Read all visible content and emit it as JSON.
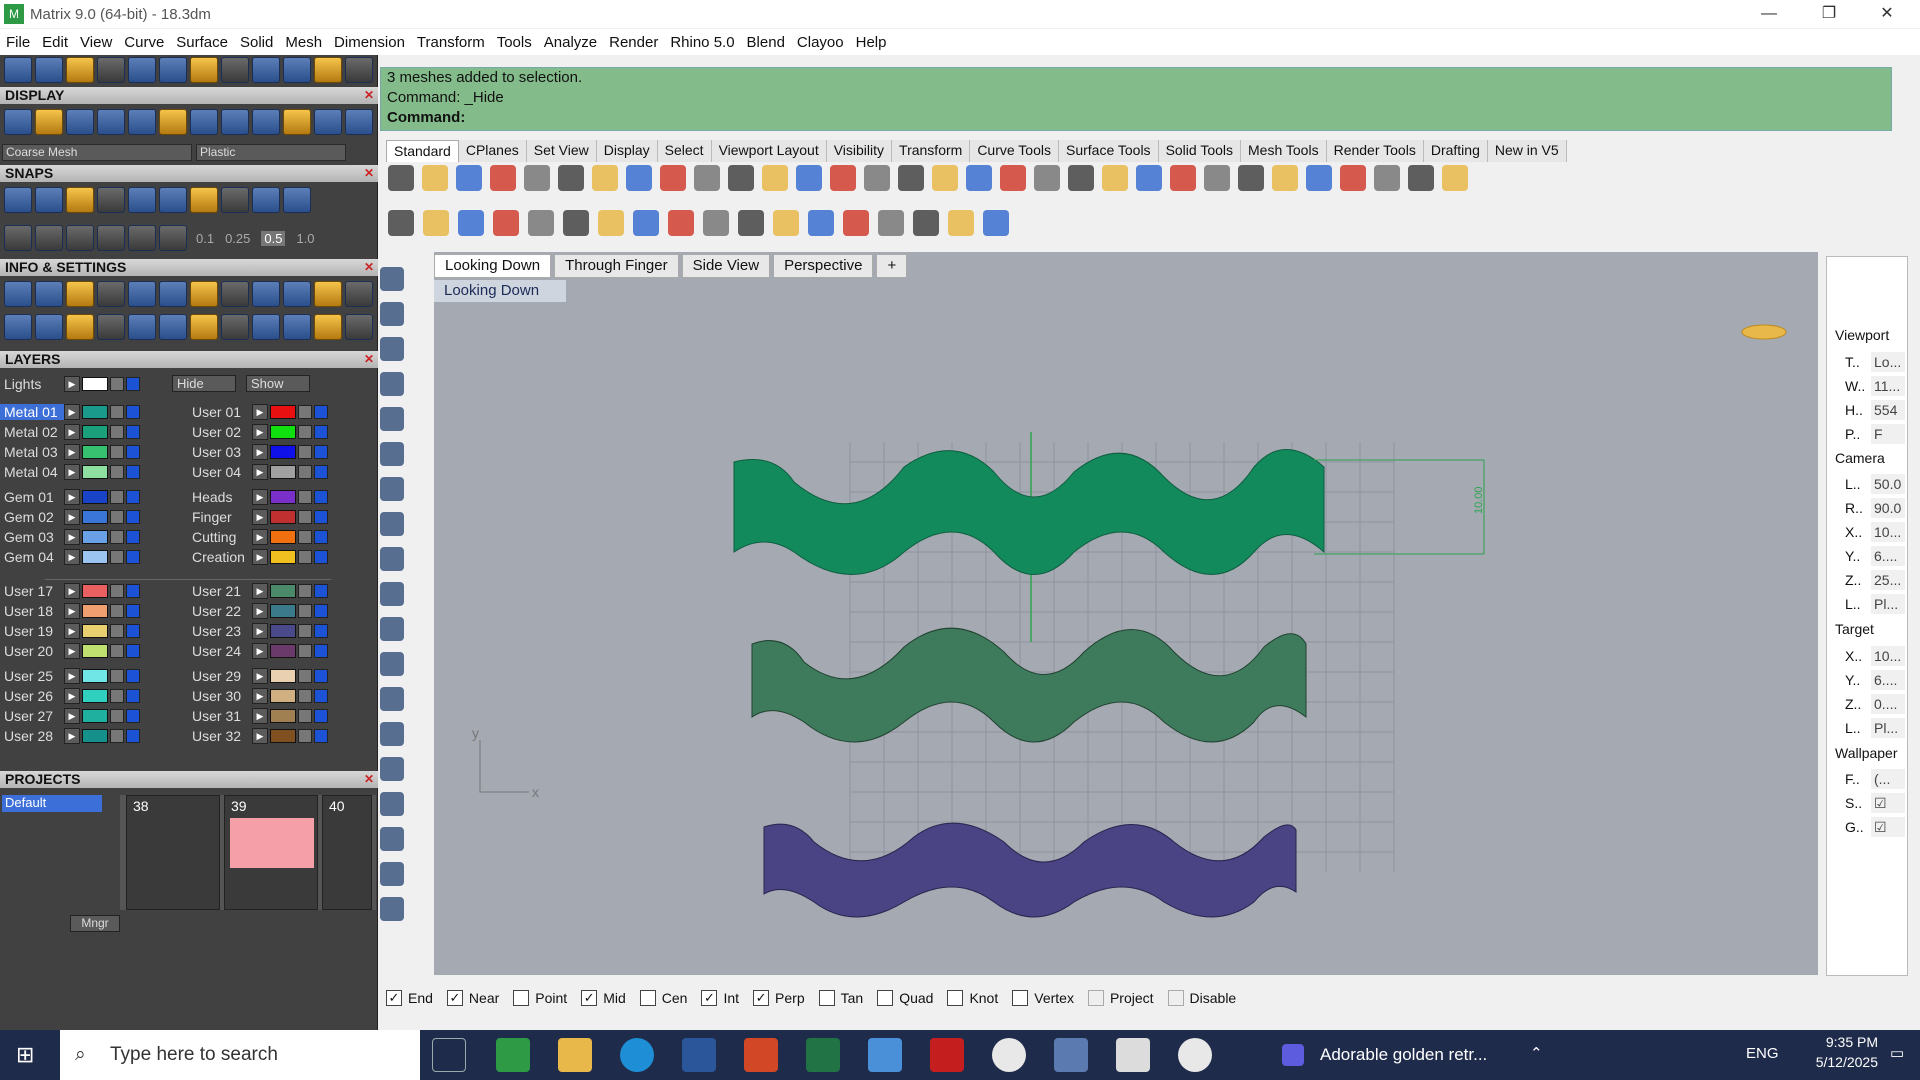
{
  "window": {
    "title": "Matrix 9.0 (64-bit) - 18.3dm",
    "min": "—",
    "restore": "❐",
    "close": "✕"
  },
  "menu": [
    "File",
    "Edit",
    "View",
    "Curve",
    "Surface",
    "Solid",
    "Mesh",
    "Dimension",
    "Transform",
    "Tools",
    "Analyze",
    "Render",
    "Rhino 5.0",
    "Blend",
    "Clayoo",
    "Help"
  ],
  "panel": {
    "display": "DISPLAY",
    "display_mode": "Coarse Mesh",
    "material": "Plastic",
    "snaps": "SNAPS",
    "snap_values": [
      "0.1",
      "0.25",
      "0.5",
      "1.0"
    ],
    "info": "INFO & SETTINGS",
    "layers": "LAYERS",
    "projects": "PROJECTS",
    "lights": "Lights",
    "hide": "Hide",
    "show": "Show",
    "layers_left": [
      {
        "name": "Metal 01",
        "color": "#1a9a8a",
        "selected": true
      },
      {
        "name": "Metal 02",
        "color": "#1aa07a"
      },
      {
        "name": "Metal 03",
        "color": "#36c070"
      },
      {
        "name": "Metal 04",
        "color": "#8ee0a0"
      },
      {
        "name": "Gem 01",
        "color": "#1a44c8"
      },
      {
        "name": "Gem 02",
        "color": "#3a76d8"
      },
      {
        "name": "Gem 03",
        "color": "#6aa0e6"
      },
      {
        "name": "Gem 04",
        "color": "#9cc4f0"
      },
      {
        "name": "User 17",
        "color": "#ea6060"
      },
      {
        "name": "User 18",
        "color": "#f0a070"
      },
      {
        "name": "User 19",
        "color": "#e8d070"
      },
      {
        "name": "User 20",
        "color": "#c0e070"
      },
      {
        "name": "User 25",
        "color": "#70e6e6"
      },
      {
        "name": "User 26",
        "color": "#30d0c0"
      },
      {
        "name": "User 27",
        "color": "#20b0a0"
      },
      {
        "name": "User 28",
        "color": "#16908a"
      }
    ],
    "layers_right": [
      {
        "name": "User 01",
        "color": "#e81010"
      },
      {
        "name": "User 02",
        "color": "#10e010"
      },
      {
        "name": "User 03",
        "color": "#1010e8"
      },
      {
        "name": "User 04",
        "color": "#a0a0a0"
      },
      {
        "name": "Heads",
        "color": "#7a30c8"
      },
      {
        "name": "Finger",
        "color": "#c03030"
      },
      {
        "name": "Cutting",
        "color": "#f07010"
      },
      {
        "name": "Creation",
        "color": "#f0c020"
      },
      {
        "name": "User 21",
        "color": "#4a8a6a"
      },
      {
        "name": "User 22",
        "color": "#3a7a8a"
      },
      {
        "name": "User 23",
        "color": "#4a4a8a"
      },
      {
        "name": "User 24",
        "color": "#6a3a6a"
      },
      {
        "name": "User 29",
        "color": "#e8d0b0"
      },
      {
        "name": "User 30",
        "color": "#d0b080"
      },
      {
        "name": "User 31",
        "color": "#a08050"
      },
      {
        "name": "User 32",
        "color": "#805020"
      }
    ],
    "project_default": "Default",
    "thumbs": [
      "38",
      "39",
      "40"
    ],
    "mngr": "Mngr"
  },
  "command": {
    "line1": "3 meshes added to selection.",
    "line2": "Command: _Hide",
    "line3": "Command:"
  },
  "tabs": [
    "Standard",
    "CPlanes",
    "Set View",
    "Display",
    "Select",
    "Viewport Layout",
    "Visibility",
    "Transform",
    "Curve Tools",
    "Surface Tools",
    "Solid Tools",
    "Mesh Tools",
    "Render Tools",
    "Drafting",
    "New in V5"
  ],
  "viewport": {
    "tabs": [
      "Looking Down",
      "Through Finger",
      "Side View",
      "Perspective",
      "+"
    ],
    "label": "Looking Down",
    "dimension": "10.00",
    "axis_y": "y",
    "axis_x": "x"
  },
  "properties": {
    "viewport": "Viewport",
    "camera": "Camera",
    "target": "Target",
    "wallpaper": "Wallpaper",
    "vp_rows": [
      {
        "k": "T..",
        "v": "Lo..."
      },
      {
        "k": "W..",
        "v": "11..."
      },
      {
        "k": "H..",
        "v": "554"
      },
      {
        "k": "P..",
        "v": "F"
      }
    ],
    "cam_rows": [
      {
        "k": "L..",
        "v": "50.0"
      },
      {
        "k": "R..",
        "v": "90.0"
      },
      {
        "k": "X..",
        "v": "10..."
      },
      {
        "k": "Y..",
        "v": "6...."
      },
      {
        "k": "Z..",
        "v": "25..."
      },
      {
        "k": "L..",
        "v": "Pl..."
      }
    ],
    "tgt_rows": [
      {
        "k": "X..",
        "v": "10..."
      },
      {
        "k": "Y..",
        "v": "6...."
      },
      {
        "k": "Z..",
        "v": "0...."
      },
      {
        "k": "L..",
        "v": "Pl..."
      }
    ],
    "wp_rows": [
      {
        "k": "F..",
        "v": "(..."
      },
      {
        "k": "S..",
        "v": "☑"
      },
      {
        "k": "G..",
        "v": "☑"
      }
    ]
  },
  "osnaps": [
    {
      "l": "End",
      "c": true
    },
    {
      "l": "Near",
      "c": true
    },
    {
      "l": "Point",
      "c": false
    },
    {
      "l": "Mid",
      "c": true
    },
    {
      "l": "Cen",
      "c": false
    },
    {
      "l": "Int",
      "c": true
    },
    {
      "l": "Perp",
      "c": true
    },
    {
      "l": "Tan",
      "c": false
    },
    {
      "l": "Quad",
      "c": false
    },
    {
      "l": "Knot",
      "c": false
    },
    {
      "l": "Vertex",
      "c": false
    },
    {
      "l": "Project",
      "c": false,
      "d": true
    },
    {
      "l": "Disable",
      "c": false,
      "d": true
    }
  ],
  "taskbar": {
    "search": "Type here to search",
    "media": "Adorable golden retr...",
    "lang": "ENG",
    "time": "9:35 PM",
    "date": "5/12/2025"
  }
}
